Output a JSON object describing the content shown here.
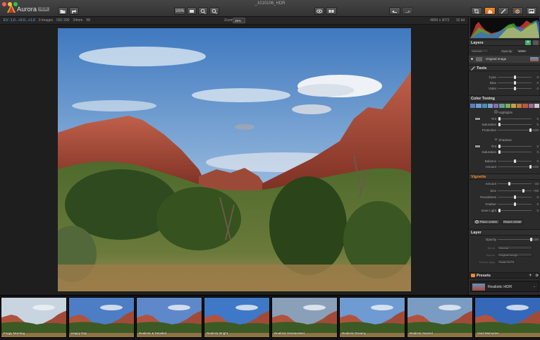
{
  "window": {
    "title": "_1010106_HDR"
  },
  "app": {
    "name": "Aurora",
    "edition": "HDR"
  },
  "toolbar": {
    "zoom_fit": "100%"
  },
  "infobar": {
    "ev": "EV  -1.0...+0.0...+1.0",
    "images": "3 images",
    "iso": "ISO 200",
    "focal": "34mm",
    "aperture": "f/8",
    "zoom_label": "Zoom",
    "zoom_value": "35%",
    "dimensions": "4899 x 3072",
    "bit_depth": "16 bit"
  },
  "layers": {
    "header": "Layers",
    "blend_mode": "Normal",
    "opacity_label": "Opacity:",
    "opacity_value": "100%",
    "layer_name": "Original Image"
  },
  "tools": {
    "header": "Tools",
    "sliders": [
      {
        "label": "Cyan",
        "value": "0",
        "pos": 0.5
      },
      {
        "label": "Blue",
        "value": "0",
        "pos": 0.5
      },
      {
        "label": "Violet",
        "value": "0",
        "pos": 0.5
      }
    ]
  },
  "color_toning": {
    "header": "Color Toning",
    "highlights_label": "Highlights",
    "highlights": [
      {
        "label": "Tint",
        "value": "0",
        "pos": 0.02
      },
      {
        "label": "Saturation",
        "value": "0",
        "pos": 0.02
      },
      {
        "label": "Protection",
        "value": "+100",
        "pos": 0.98
      }
    ],
    "shadows_label": "Shadows",
    "shadows": [
      {
        "label": "Tint",
        "value": "0",
        "pos": 0.02
      },
      {
        "label": "Saturation",
        "value": "0",
        "pos": 0.02
      }
    ],
    "balance": [
      {
        "label": "Balance",
        "value": "0",
        "pos": 0.5
      },
      {
        "label": "Amount",
        "value": "+100",
        "pos": 0.98
      }
    ]
  },
  "vignette": {
    "header": "Vignette",
    "sliders": [
      {
        "label": "Amount",
        "value": "-33",
        "pos": 0.33
      },
      {
        "label": "Size",
        "value": "+50",
        "pos": 0.75
      },
      {
        "label": "Roundness",
        "value": "0",
        "pos": 0.5
      },
      {
        "label": "Feather",
        "value": "0",
        "pos": 0.5
      },
      {
        "label": "Inner Light",
        "value": "0",
        "pos": 0.02
      }
    ],
    "place_center": "Place center",
    "reset_center": "Reset center"
  },
  "layer_section": {
    "header": "Layer",
    "opacity_label": "Opacity",
    "opacity_value": "+100",
    "blend_label": "Blend",
    "blend_value": "Normal",
    "source_label": "Source",
    "source_value": "Original Image",
    "texture_label": "Texture align",
    "texture_value": "Scale To Fit"
  },
  "presets": {
    "header": "Presets",
    "current": "Realistic HDR"
  },
  "filmstrip": [
    {
      "label": "Foggy Morning"
    },
    {
      "label": "Happy Day"
    },
    {
      "label": "Realistic & Detailed"
    },
    {
      "label": "Realistic Bright"
    },
    {
      "label": "Realistic Desaturated"
    },
    {
      "label": "Realistic Dreamy"
    },
    {
      "label": "Realistic Neutral"
    },
    {
      "label": "Vivid Memories"
    }
  ],
  "colors": {
    "accent_blue": "#5fb0e6",
    "accent_orange": "#f08a2e",
    "panel_bg": "#2b2b2b"
  }
}
